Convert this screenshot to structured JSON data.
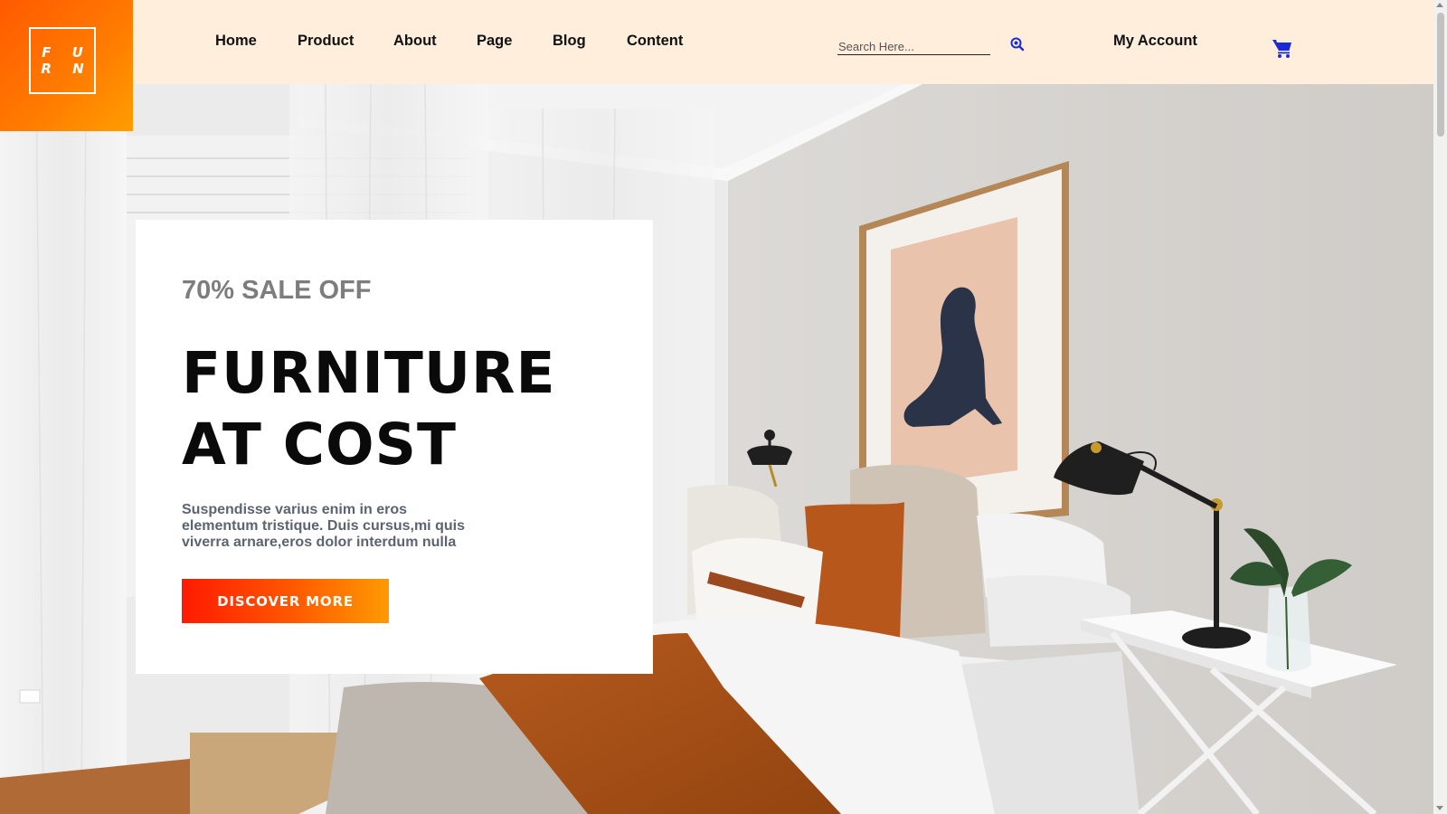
{
  "brand": {
    "logo_line1": "F U",
    "logo_line2": "R N",
    "accent_gradient": [
      "#ff5a00",
      "#ff9d00"
    ]
  },
  "nav": {
    "items": [
      {
        "label": "Home"
      },
      {
        "label": "Product"
      },
      {
        "label": "About"
      },
      {
        "label": "Page"
      },
      {
        "label": "Blog"
      },
      {
        "label": "Content"
      }
    ]
  },
  "search": {
    "placeholder": "Search Here...",
    "value": "",
    "icon": "search-icon",
    "icon_color": "#1a2bd6"
  },
  "account": {
    "label": "My Account"
  },
  "cart": {
    "icon": "cart-icon",
    "icon_color": "#1a2bd6"
  },
  "hero": {
    "eyebrow": "70% SALE OFF",
    "headline_line1": "FURNITURE",
    "headline_line2": "AT COST",
    "body": "Suspendisse varius enim in eros elementum tristique. Duis cursus,mi quis viverra arnare,eros dolor interdum nulla",
    "cta_label": "DISCOVER MORE",
    "image": "bedroom-interior-photo"
  },
  "colors": {
    "header_bg": "#ffeedb",
    "cta_gradient": [
      "#ff1a00",
      "#ff9a00"
    ]
  }
}
